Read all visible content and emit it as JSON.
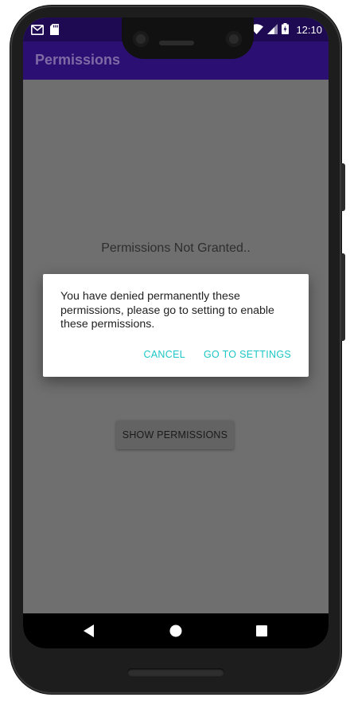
{
  "status_bar": {
    "time": "12:10",
    "icons_left": [
      "gmail-icon",
      "sd-card-icon"
    ],
    "icons_right": [
      "wifi-icon",
      "cell-signal-icon",
      "battery-charging-icon"
    ]
  },
  "app_bar": {
    "title": "Permissions"
  },
  "main": {
    "status_text": "Permissions Not Granted..",
    "show_button_label": "SHOW PERMISSIONS"
  },
  "dialog": {
    "message": "You have denied permanently these permissions, please go to setting to enable these permissions.",
    "cancel_label": "CANCEL",
    "settings_label": "GO TO SETTINGS"
  },
  "nav_bar": {
    "icons": [
      "back-icon",
      "home-icon",
      "recent-apps-icon"
    ]
  },
  "colors": {
    "status_bar": "#1d0a52",
    "app_bar": "#2c0f72",
    "dialog_accent": "#1dc6c6",
    "scrim_background": "#6f6f6f"
  }
}
